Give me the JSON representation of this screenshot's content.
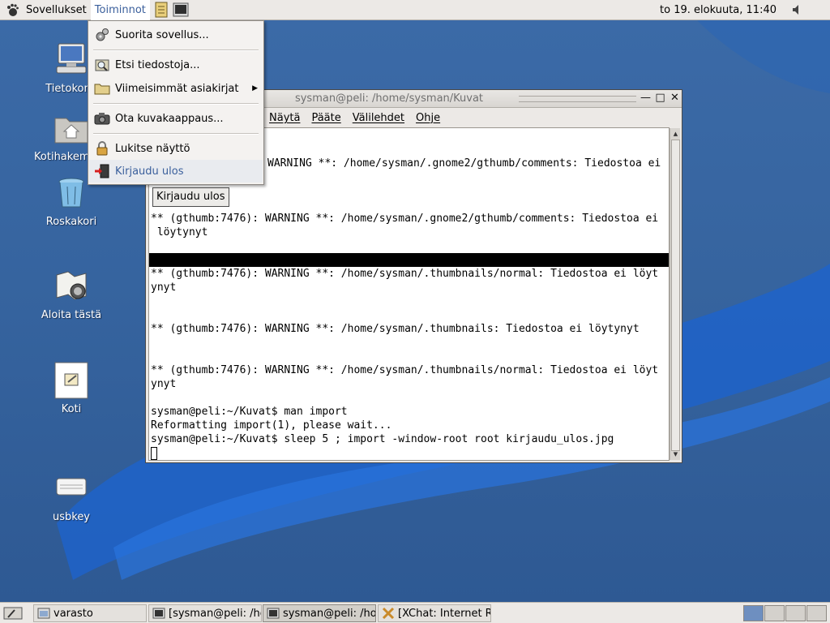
{
  "top_panel": {
    "menus": [
      "Sovellukset",
      "Toiminnot"
    ],
    "clock": "to 19. elokuuta, 11:40",
    "icons": [
      "gnome-foot-icon",
      "text-editor-launcher-icon",
      "terminal-launcher-icon",
      "volume-icon"
    ]
  },
  "actions_menu": {
    "items": [
      {
        "label": "Suorita sovellus...",
        "icon": "run-gears-icon"
      },
      {
        "label": "Etsi tiedostoja...",
        "icon": "search-files-icon"
      },
      {
        "label": "Viimeisimmät asiakirjat",
        "icon": "folder-icon",
        "submenu": true
      },
      {
        "label": "Ota kuvakaappaus...",
        "icon": "camera-icon"
      },
      {
        "label": "Lukitse näyttö",
        "icon": "padlock-icon"
      },
      {
        "label": "Kirjaudu ulos",
        "icon": "logout-door-icon"
      }
    ],
    "highlighted": "Kirjaudu ulos"
  },
  "desktop_icons": [
    {
      "label": "Tietokone",
      "icon": "computer-icon"
    },
    {
      "label": "Kotihakemisto",
      "icon": "home-folder-icon"
    },
    {
      "label": "Roskakori",
      "icon": "trash-icon"
    },
    {
      "label": "Aloita tästä",
      "icon": "start-here-compass-icon"
    },
    {
      "label": "Koti",
      "icon": "document-icon"
    },
    {
      "label": "usbkey",
      "icon": "usb-drive-icon"
    }
  ],
  "terminal": {
    "title": "sysman@peli: /home/sysman/Kuvat",
    "menubar": [
      "Näytä",
      "Pääte",
      "Välilehdet",
      "Ohje"
    ],
    "embedded_button": "Kirjaudu ulos",
    "lines": [
      "WARNING **: /home/sysman/.gnome2/gthumb/comments: Tiedostoa ei",
      "** (gthumb:7476): WARNING **: /home/sysman/.gnome2/gthumb/comments: Tiedostoa ei",
      " löytynyt",
      "** (gthumb:7476): WARNING **: /home/sysman/.thumbnails/normal: Tiedostoa ei löyt",
      "ynyt",
      "** (gthumb:7476): WARNING **: /home/sysman/.thumbnails: Tiedostoa ei löytynyt",
      "** (gthumb:7476): WARNING **: /home/sysman/.thumbnails/normal: Tiedostoa ei löyt",
      "ynyt",
      "sysman@peli:~/Kuvat$ man import",
      "Reformatting import(1), please wait...",
      "sysman@peli:~/Kuvat$ sleep 5 ; import -window-root root kirjaudu_ulos.jpg"
    ]
  },
  "taskbar": {
    "tasks": [
      {
        "label": "varasto",
        "icon": "folder-window-icon"
      },
      {
        "label": "[sysman@peli: /hc",
        "icon": "terminal-task-icon"
      },
      {
        "label": "sysman@peli: /hor",
        "icon": "terminal-task-icon"
      },
      {
        "label": "[XChat: Internet R",
        "icon": "xchat-icon"
      }
    ],
    "workspaces": 4,
    "current_workspace": 1
  },
  "colors": {
    "desktop_bg": "#36649f",
    "menu_highlight_text": "#3a5f9c",
    "panel_bg": "#ece9e6"
  }
}
